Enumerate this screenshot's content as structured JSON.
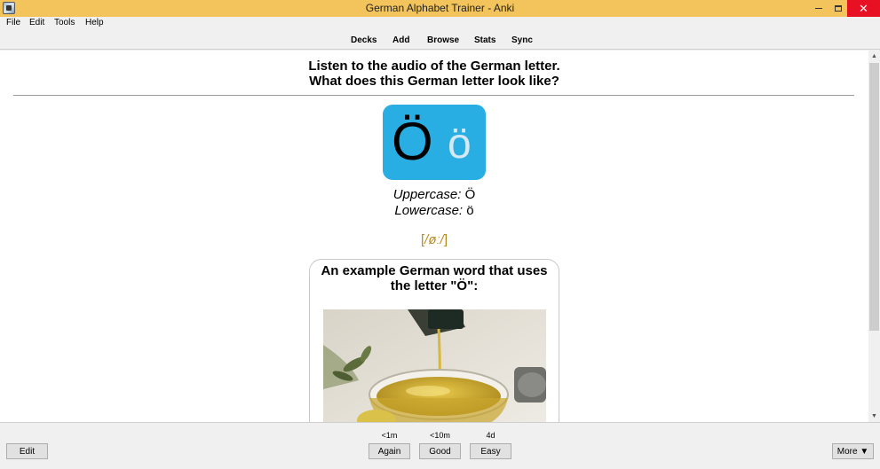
{
  "window": {
    "title": "German Alphabet Trainer - Anki",
    "close_glyph": "✕"
  },
  "menu": [
    "File",
    "Edit",
    "Tools",
    "Help"
  ],
  "toolbar": [
    "Decks",
    "Add",
    "Browse",
    "Stats",
    "Sync"
  ],
  "card": {
    "question_line1": "Listen to the audio of the German letter.",
    "question_line2": "What does this German letter look like?",
    "uppercase_glyph": "Ö",
    "lowercase_glyph": "ö",
    "uppercase_label": "Uppercase:",
    "uppercase_value": "Ö",
    "lowercase_label": "Lowercase:",
    "lowercase_value": "ö",
    "ipa_open": "[",
    "ipa_inner": "/øː/",
    "ipa_close": "]",
    "example_title": "An example German word that uses the letter \"Ö\":"
  },
  "colors": {
    "titlebar": "#f2c45b",
    "letter_card": "#29aee3",
    "ipa_text": "#b58a1e",
    "close_button": "#e81123"
  },
  "scrollbar": {
    "up_icon": "▲",
    "down_icon": "▼"
  },
  "bottom": {
    "edit_label": "Edit",
    "more_label": "More ▼",
    "answers": [
      {
        "time": "<1m",
        "label": "Again"
      },
      {
        "time": "<10m",
        "label": "Good"
      },
      {
        "time": "4d",
        "label": "Easy"
      }
    ]
  }
}
